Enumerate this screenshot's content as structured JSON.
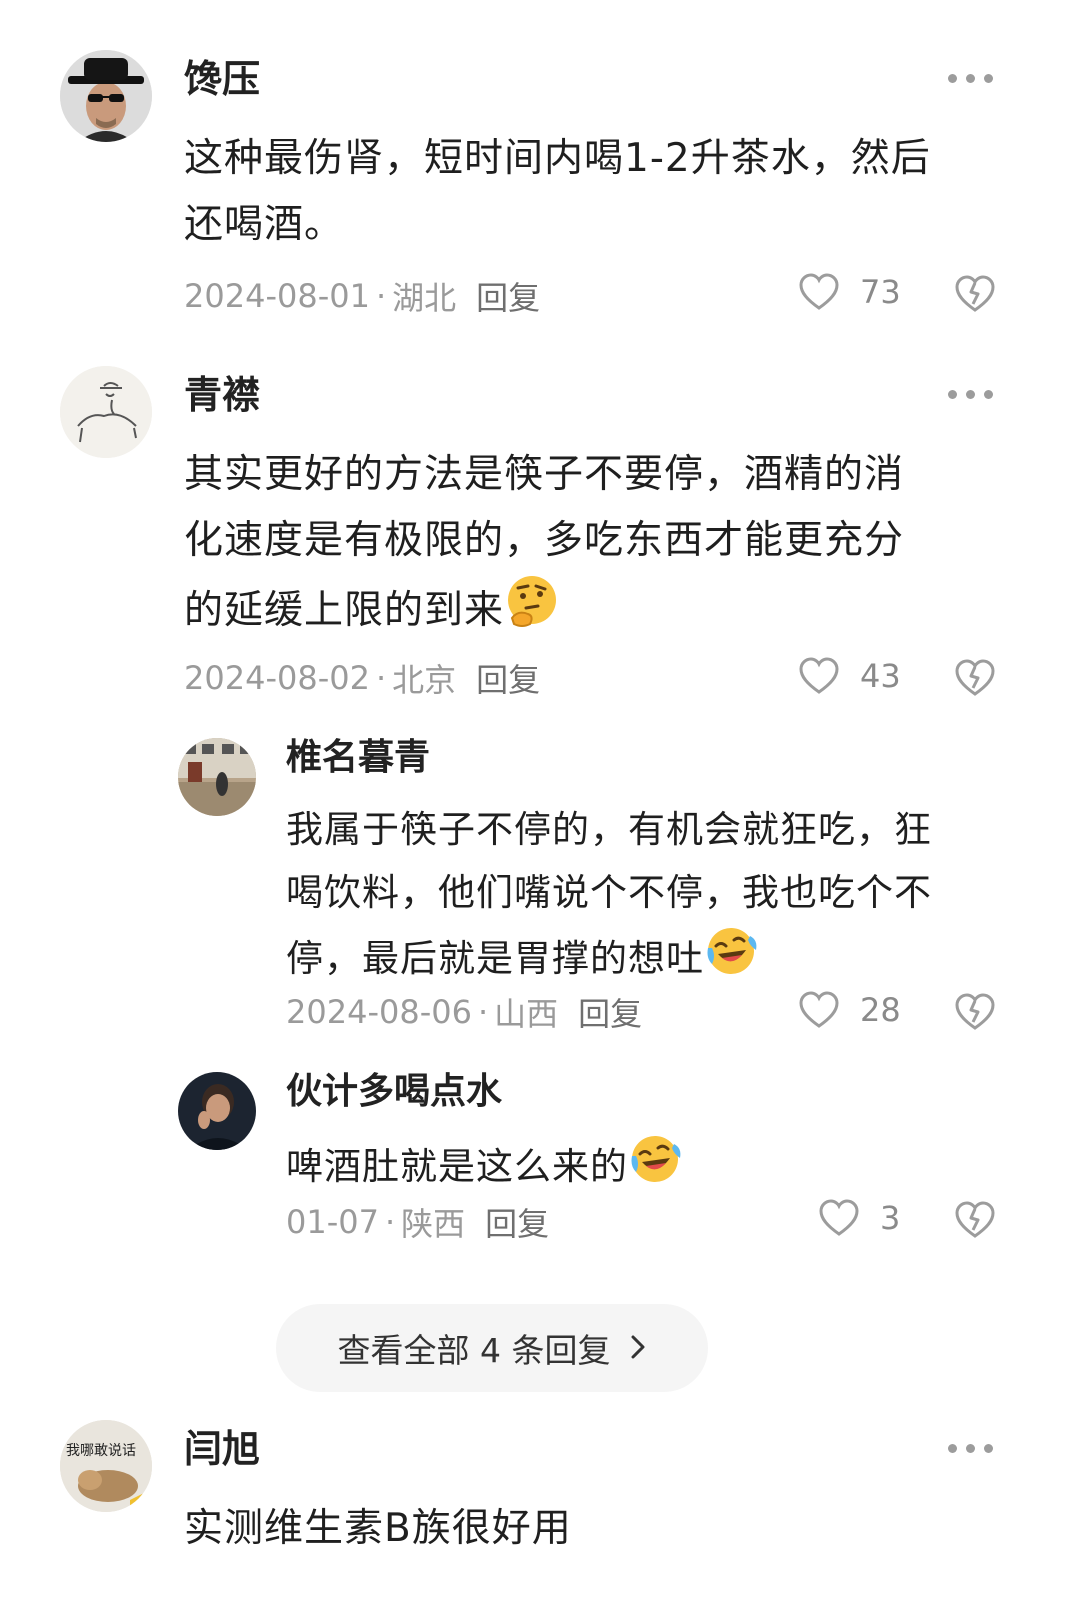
{
  "comments": [
    {
      "user": "馋压",
      "text": "这种最伤肾，短时间内喝1-2升茶水，然后还喝酒。",
      "lines": [
        "这种最伤肾，短时间内喝1-2升茶水，然后",
        "还喝酒。"
      ],
      "date": "2024-08-01",
      "region": "湖北",
      "reply_label": "回复",
      "likes": "73"
    },
    {
      "user": "青襟",
      "lines": [
        "其实更好的方法是筷子不要停，酒精的消",
        "化速度是有极限的，多吃东西才能更充分",
        "的延缓上限的到来"
      ],
      "date": "2024-08-02",
      "region": "北京",
      "reply_label": "回复",
      "likes": "43",
      "replies": [
        {
          "user": "椎名暮青",
          "lines": [
            "我属于筷子不停的，有机会就狂吃，狂",
            "喝饮料，他们嘴说个不停，我也吃个不",
            "停，最后就是胃撑的想吐"
          ],
          "date": "2024-08-06",
          "region": "山西",
          "reply_label": "回复",
          "likes": "28"
        },
        {
          "user": "伙计多喝点水",
          "lines": [
            "啤酒肚就是这么来的"
          ],
          "date": "01-07",
          "region": "陕西",
          "reply_label": "回复",
          "likes": "3"
        }
      ],
      "view_all_label": "查看全部 4 条回复"
    },
    {
      "user": "闫旭",
      "avatar_text": "我哪敢说话",
      "lines": [
        "实测维生素B族很好用"
      ]
    }
  ],
  "separator": " · ",
  "icons": [
    "more-icon",
    "heart-icon",
    "dislike-icon",
    "thinking-emoji",
    "laugh-cry-emoji",
    "chevron-right-icon"
  ],
  "colors": {
    "text": "#1f1f1f",
    "meta": "#9a9a9a",
    "icon": "#9c9c9c",
    "pill_bg": "#f5f5f5"
  }
}
